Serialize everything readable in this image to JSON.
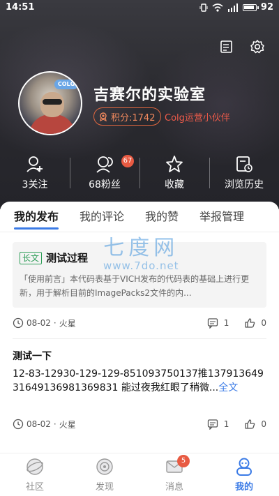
{
  "status_bar": {
    "time": "14:51",
    "battery": "92"
  },
  "profile": {
    "name": "吉赛尔的实验室",
    "points_label": "积分:1742",
    "role": "Colg运营小伙伴",
    "avatar_tag": "COLG"
  },
  "stats": [
    {
      "label": "3关注",
      "icon": "add-user-icon"
    },
    {
      "label": "68粉丝",
      "icon": "fans-icon",
      "badge": "67"
    },
    {
      "label": "收藏",
      "icon": "star-icon"
    },
    {
      "label": "浏览历史",
      "icon": "history-icon"
    }
  ],
  "tabs": [
    "我的发布",
    "我的评论",
    "我的赞",
    "举报管理"
  ],
  "posts": [
    {
      "tag": "长文",
      "title": "测试过程",
      "excerpt": "「使用前言」本代码表基于VICH发布的代码表的基础上进行更新，用于解析目前的ImagePacks2文件的内...",
      "date": "08-02",
      "board": "火星",
      "comments": "1",
      "likes": "0"
    },
    {
      "title": "测试一下",
      "body": "12-83-12930-129-129-851093750137推1379136493164913698136983​1 能过夜我红眼了稍微...",
      "more": "全文",
      "date": "08-02",
      "board": "火星",
      "comments": "1",
      "likes": "0"
    }
  ],
  "watermark": {
    "big": "七度网",
    "small": "www.7do.net"
  },
  "bottom_nav": [
    {
      "label": "社区",
      "icon": "community-icon"
    },
    {
      "label": "发现",
      "icon": "discover-icon"
    },
    {
      "label": "消息",
      "icon": "message-icon",
      "badge": "5"
    },
    {
      "label": "我的",
      "icon": "profile-icon",
      "active": true
    }
  ],
  "colors": {
    "accent": "#3b7be6",
    "points_border": "#e0673f",
    "role_text": "#ef5b4a",
    "badge_red": "#e85a42",
    "tag_green": "#2f9e59"
  }
}
